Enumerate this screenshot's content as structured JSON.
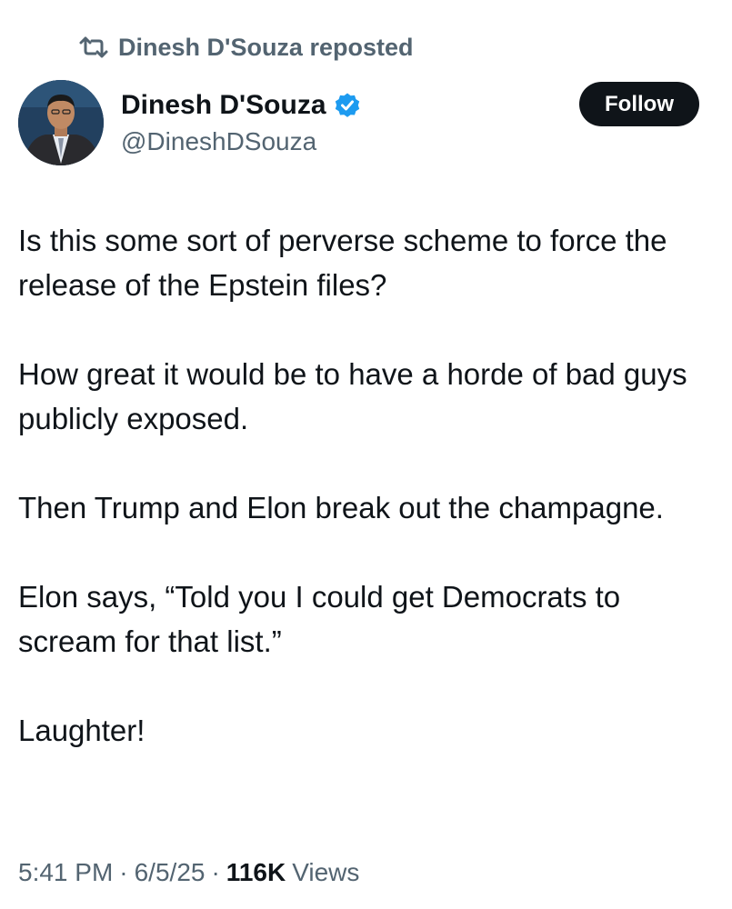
{
  "repost": {
    "icon": "repost-icon",
    "text": "Dinesh D'Souza reposted"
  },
  "author": {
    "display_name": "Dinesh D'Souza",
    "handle": "@DineshDSouza",
    "verified_icon": "verified-badge-icon",
    "avatar": "avatar-photo"
  },
  "follow_button": {
    "label": "Follow"
  },
  "tweet": {
    "paragraphs": [
      "Is this some sort of perverse scheme to force the release of the Epstein files?",
      "How great it would be to have a horde of bad guys publicly exposed.",
      "Then Trump and Elon break out the champagne.",
      "Elon says, “Told you I could get Democrats to scream for that list.”",
      "Laughter!"
    ]
  },
  "meta": {
    "time": "5:41 PM",
    "separator": "·",
    "date": "6/5/25",
    "views_count": "116K",
    "views_label": "Views"
  },
  "colors": {
    "text_primary": "#0f1419",
    "text_secondary": "#536471",
    "verified_blue": "#1d9bf0",
    "follow_bg": "#0f1419",
    "background": "#ffffff"
  }
}
